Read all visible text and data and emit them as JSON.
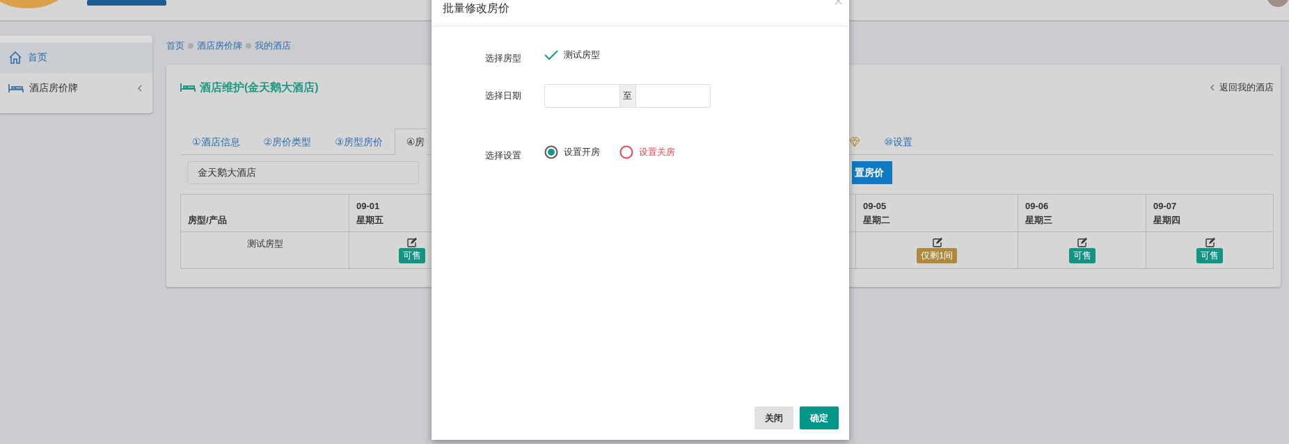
{
  "sidebar": {
    "items": [
      {
        "label": "首页",
        "kind": "home",
        "selected": true,
        "expandable": false
      },
      {
        "label": "酒店房价牌",
        "kind": "bed",
        "selected": false,
        "expandable": true
      }
    ]
  },
  "breadcrumb": [
    "首页",
    "酒店房价牌",
    "我的酒店"
  ],
  "panel": {
    "title": "酒店维护(金天鹅大酒店)",
    "back_link": "返回我的酒店"
  },
  "tabs": [
    {
      "kind": "text",
      "label": "①酒店信息",
      "selected": false
    },
    {
      "kind": "text",
      "label": "②房价类型",
      "selected": false
    },
    {
      "kind": "text",
      "label": "③房型房价",
      "selected": false
    },
    {
      "kind": "text",
      "label": "④房",
      "selected": true
    },
    {
      "kind": "icon",
      "selected": false
    },
    {
      "kind": "text",
      "label": "⑩设置",
      "selected": false
    }
  ],
  "hotel_select": {
    "value": "金天鹅大酒店"
  },
  "set_price_button": "置房价",
  "table": {
    "columns": [
      {
        "label": "房型/产品"
      },
      {
        "date": "09-01",
        "weekday": "星期五"
      },
      {
        "date": "09-05",
        "weekday": "星期二"
      },
      {
        "date": "09-06",
        "weekday": "星期三"
      },
      {
        "date": "09-07",
        "weekday": "星期四"
      }
    ],
    "rows": [
      {
        "cells": [
          {
            "kind": "name",
            "text": "测试房型"
          },
          {
            "kind": "available",
            "status": "可售"
          },
          {
            "kind": "few",
            "status": "仅剩1间"
          },
          {
            "kind": "available",
            "status": "可售"
          },
          {
            "kind": "available",
            "status": "可售"
          }
        ]
      }
    ]
  },
  "modal": {
    "title": "批量修改房价",
    "fields": [
      {
        "kind": "check",
        "label": "选择房型",
        "options": [
          {
            "label": "测试房型",
            "checked": true
          }
        ]
      },
      {
        "kind": "daterange",
        "label": "选择日期",
        "separator": "至"
      },
      {
        "kind": "radio",
        "label": "选择设置",
        "options": [
          {
            "label": "设置开房",
            "selected": true,
            "color": "#333333"
          },
          {
            "label": "设置关房",
            "selected": false,
            "color": "#f0464f"
          }
        ]
      }
    ],
    "buttons": [
      {
        "kind": "secondary",
        "label": "关闭"
      },
      {
        "kind": "primary",
        "label": "确定"
      }
    ]
  }
}
